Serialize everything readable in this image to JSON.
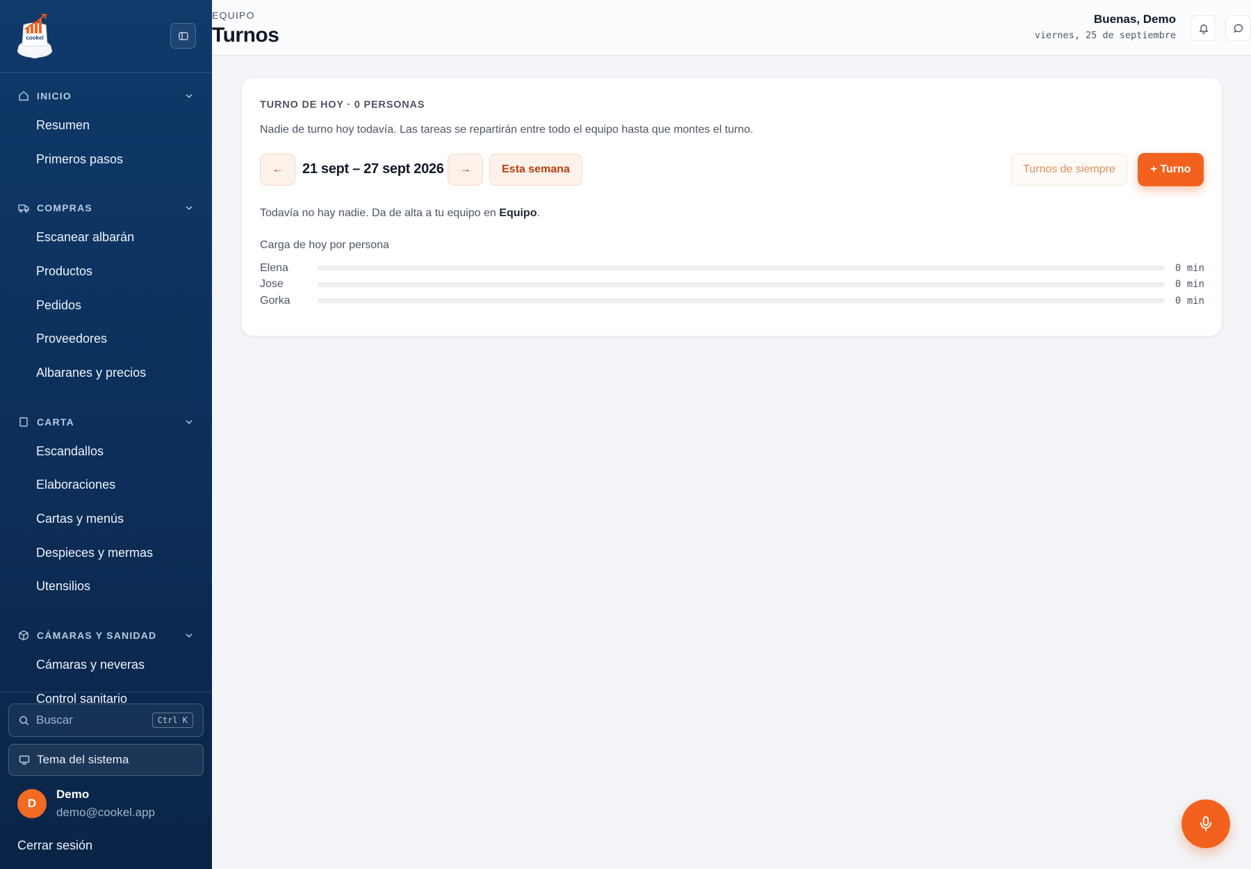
{
  "sidebar": {
    "logo_text": "cookel",
    "sections": [
      {
        "label": "INICIO",
        "icon": "home-icon",
        "items": [
          "Resumen",
          "Primeros pasos"
        ]
      },
      {
        "label": "COMPRAS",
        "icon": "truck-icon",
        "items": [
          "Escanear albarán",
          "Productos",
          "Pedidos",
          "Proveedores",
          "Albaranes y precios"
        ]
      },
      {
        "label": "CARTA",
        "icon": "book-icon",
        "items": [
          "Escandallos",
          "Elaboraciones",
          "Cartas y menús",
          "Despieces y mermas",
          "Utensilios"
        ]
      },
      {
        "label": "CÁMARAS Y SANIDAD",
        "icon": "box-icon",
        "items": [
          "Cámaras y neveras",
          "Control sanitario"
        ]
      }
    ],
    "search": {
      "placeholder": "Buscar",
      "shortcut": "Ctrl K"
    },
    "theme_label": "Tema del sistema",
    "user": {
      "initial": "D",
      "name": "Demo",
      "email": "demo@cookel.app"
    },
    "logout_label": "Cerrar sesión"
  },
  "header": {
    "eyebrow": "EQUIPO",
    "title": "Turnos",
    "greeting": "Buenas, Demo",
    "date": "viernes, 25 de septiembre"
  },
  "card": {
    "title": "TURNO DE HOY · 0 PERSONAS",
    "description": "Nadie de turno hoy todavía. Las tareas se repartirán entre todo el equipo hasta que montes el turno.",
    "prev_label": "←",
    "next_label": "→",
    "range": "21 sept – 27 sept 2026",
    "this_week_label": "Esta semana",
    "always_label": "Turnos de siempre",
    "add_label": "+ Turno",
    "empty_prefix": "Todavía no hay nadie. Da de alta a tu equipo en ",
    "empty_link": "Equipo",
    "empty_suffix": ".",
    "load_title": "Carga de hoy por persona",
    "load": [
      {
        "name": "Elena",
        "value": "0 min",
        "fraction": 0
      },
      {
        "name": "Jose",
        "value": "0 min",
        "fraction": 0
      },
      {
        "name": "Gorka",
        "value": "0 min",
        "fraction": 0
      }
    ]
  },
  "colors": {
    "accent": "#f2621e",
    "sidebar": "#0f3a6b"
  }
}
